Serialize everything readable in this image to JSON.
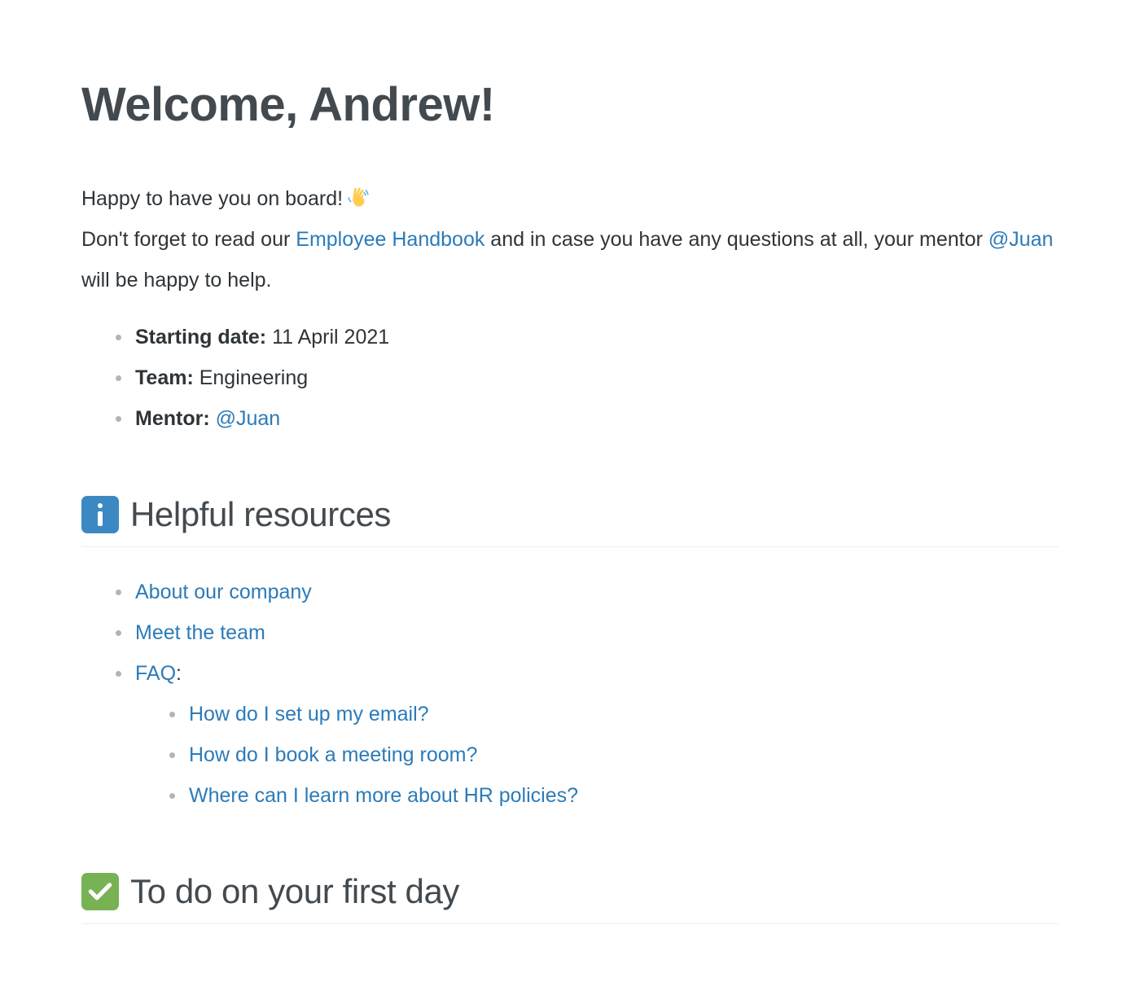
{
  "page": {
    "title": "Welcome, Andrew!"
  },
  "intro": {
    "line1_text": "Happy to have you on board!",
    "wave_emoji": "waving-hand",
    "line2_prefix": "Don't forget to read our ",
    "line2_link": "Employee Handbook",
    "line2_middle": " and in case you have any questions at all, your mentor ",
    "line2_mention": "@Juan",
    "line2_suffix": " will be happy to help."
  },
  "facts": [
    {
      "label": "Starting date:",
      "value": " 11 April 2021",
      "is_link": false
    },
    {
      "label": "Team:",
      "value": " Engineering",
      "is_link": false
    },
    {
      "label": "Mentor:",
      "value": "@Juan",
      "is_link": true
    }
  ],
  "helpful_resources": {
    "emoji": "information-source",
    "emoji_color": "#3b88c3",
    "heading": "Helpful resources",
    "items": [
      {
        "label": "About our company"
      },
      {
        "label": "Meet the team"
      },
      {
        "label": "FAQ",
        "suffix": ":"
      }
    ],
    "faq_items": [
      {
        "label": "How do I set up my email?"
      },
      {
        "label": "How do I book a meeting room?"
      },
      {
        "label": "Where can I learn more about HR policies?"
      }
    ]
  },
  "first_day": {
    "emoji": "white-check-mark",
    "emoji_color": "#77b255",
    "heading": "To do on your first day"
  },
  "colors": {
    "link": "#2b7bb9",
    "heading": "#434a4f",
    "body": "#2f3438",
    "bullet": "#adb5bd",
    "rule": "#eceef0"
  }
}
